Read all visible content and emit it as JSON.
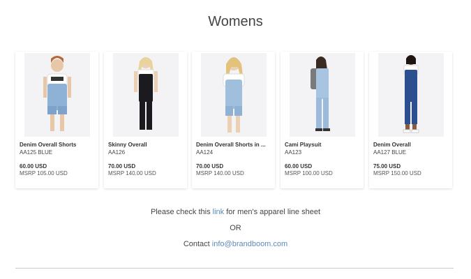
{
  "page": {
    "title": "Womens"
  },
  "products": [
    {
      "name": "Denim Overall Shorts",
      "sku": "AA125 BLUE",
      "price": "60.00 USD",
      "msrp": "MSRP 105.00 USD",
      "image_icon": "model-photo-icon"
    },
    {
      "name": "Skinny Overall",
      "sku": "AA126",
      "price": "70.00 USD",
      "msrp": "MSRP 140.00 USD",
      "image_icon": "model-photo-icon"
    },
    {
      "name": "Denim Overall Shorts in ...",
      "sku": "AA124",
      "price": "70.00 USD",
      "msrp": "MSRP 140.00 USD",
      "image_icon": "model-photo-icon"
    },
    {
      "name": "Cami Playsuit",
      "sku": "AA123",
      "price": "60.00 USD",
      "msrp": "MSRP 100.00 USD",
      "image_icon": "model-photo-icon"
    },
    {
      "name": "Denim Overall",
      "sku": "AA127 BLUE",
      "price": "75.00 USD",
      "msrp": "MSRP 150.00 USD",
      "image_icon": "model-photo-icon"
    }
  ],
  "footer": {
    "line1_prefix": "Please check this",
    "line1_link": "link",
    "line1_suffix": "for men's apparel line sheet",
    "or": "OR",
    "contact_prefix": "Contact",
    "contact_email": "info@brandboom.com"
  },
  "colors": {
    "link": "#5b8bbd",
    "divider": "#c9c9d3",
    "light_denim": "#8eb1d6",
    "dark_denim": "#2b4f8f",
    "black_overall": "#1b1b1f"
  }
}
